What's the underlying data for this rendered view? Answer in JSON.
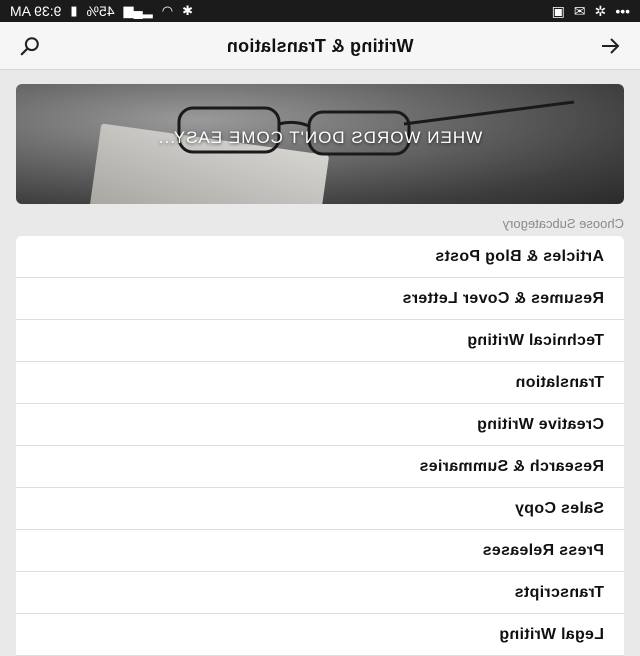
{
  "status_bar": {
    "time": "9:39 AM",
    "battery": "45%",
    "icons": [
      "battery-icon",
      "signal-icon",
      "wifi-icon",
      "bluetooth-icon",
      "image-icon",
      "mail-icon",
      "fan-icon",
      "more-icon"
    ]
  },
  "header": {
    "title": "Writing & Translation",
    "back_icon": "arrow-back-icon",
    "search_icon": "search-icon"
  },
  "banner": {
    "text": "WHEN WORDS DON'T COME EASY..."
  },
  "subcategory_label": "Choose Subcategory",
  "subcategories": [
    {
      "label": "Articles & Blog Posts"
    },
    {
      "label": "Resumes & Cover Letters"
    },
    {
      "label": "Technical Writing"
    },
    {
      "label": "Translation"
    },
    {
      "label": "Creative Writing"
    },
    {
      "label": "Research & Summaries"
    },
    {
      "label": "Sales Copy"
    },
    {
      "label": "Press Releases"
    },
    {
      "label": "Transcripts"
    },
    {
      "label": "Legal Writing"
    }
  ]
}
